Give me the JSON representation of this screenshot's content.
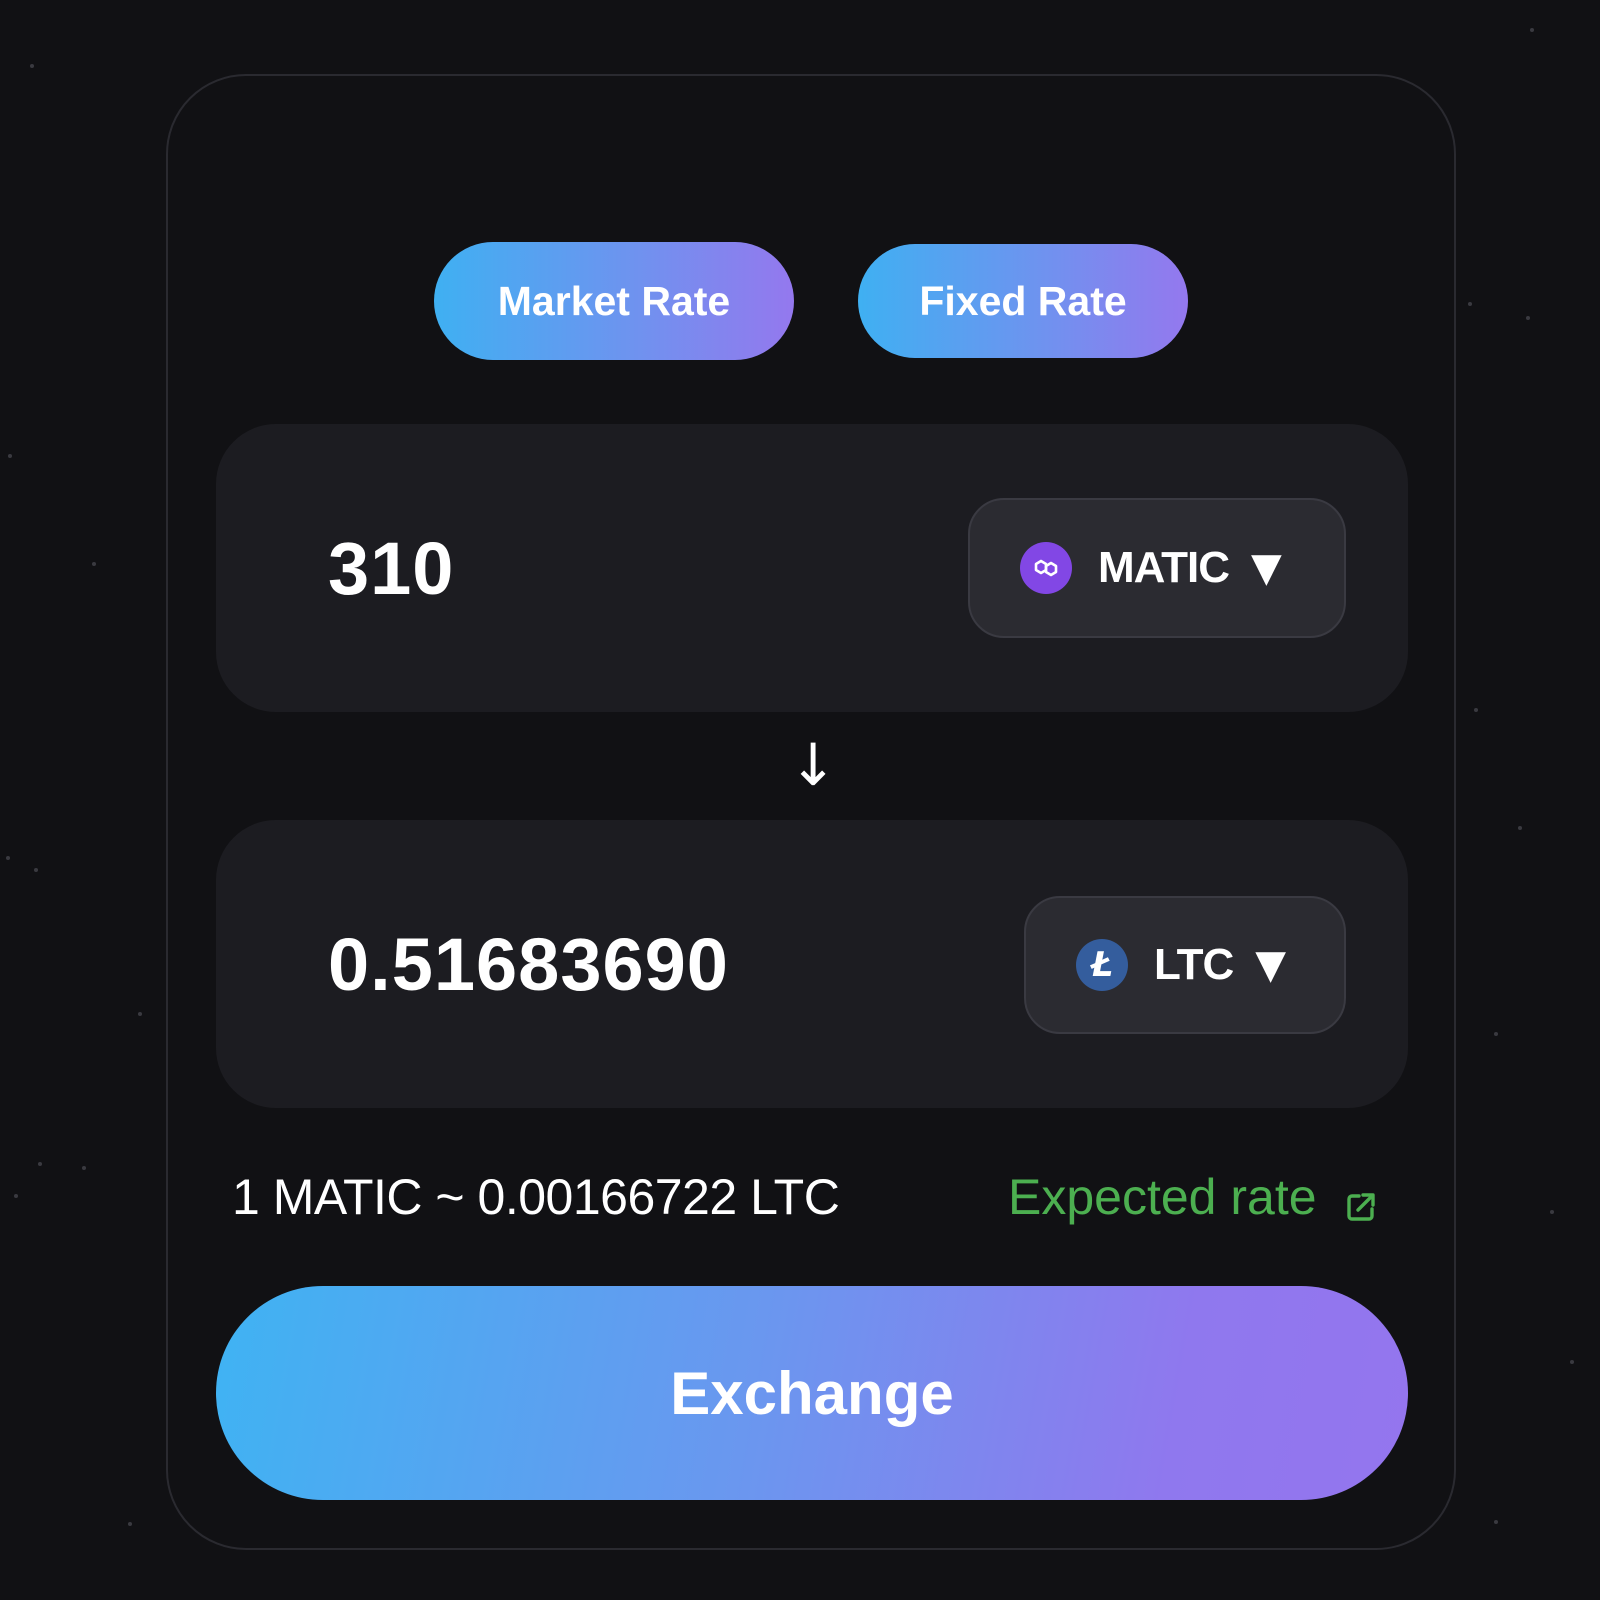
{
  "rate_tabs": {
    "market_label": "Market Rate",
    "fixed_label": "Fixed Rate"
  },
  "from": {
    "amount": "310",
    "coin": "MATIC",
    "icon": "polygon-matic-icon",
    "color": "#8247e5"
  },
  "to": {
    "amount": "0.51683690",
    "coin": "LTC",
    "icon": "litecoin-icon",
    "icon_glyph": "Ł",
    "color": "#345d9d"
  },
  "swap_arrow": "↓",
  "caret": "▼",
  "rate": {
    "text": "1 MATIC ~ 0.00166722 LTC",
    "link_label": "Expected rate",
    "link_color": "#4caf50"
  },
  "exchange_button_label": "Exchange",
  "accent_gradient": [
    "#3fb0f2",
    "#9478ee"
  ]
}
